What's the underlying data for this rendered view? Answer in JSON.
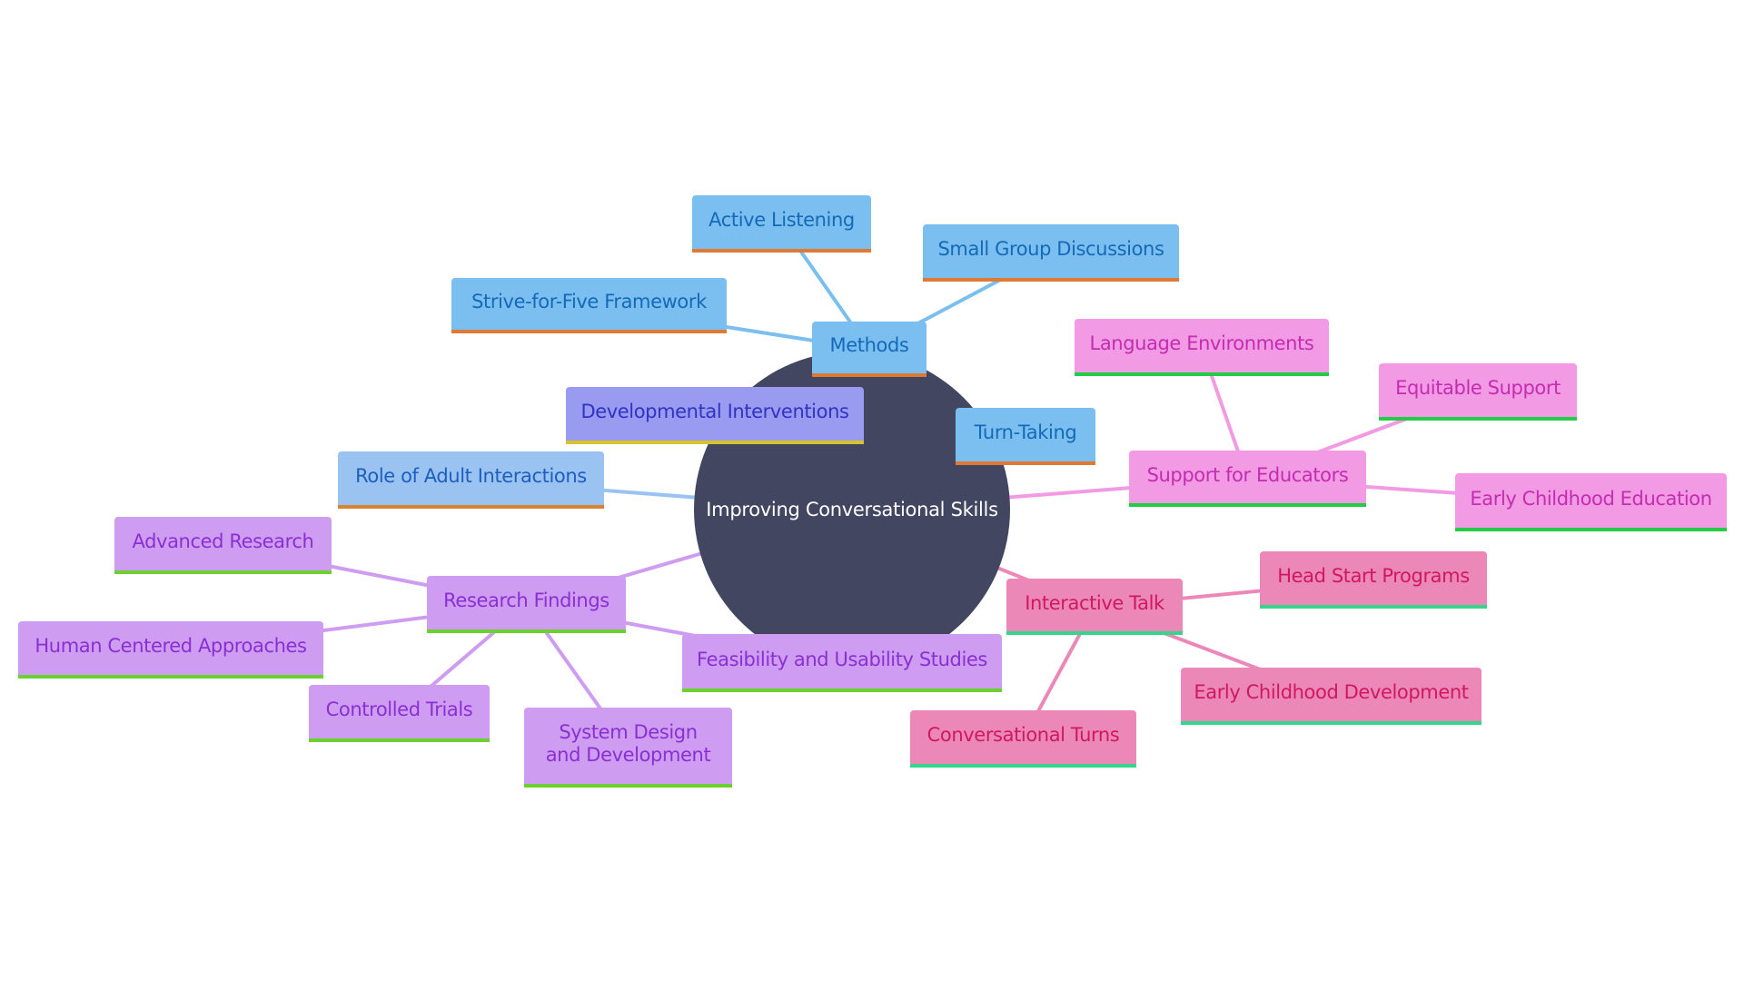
{
  "root": {
    "id": "root",
    "label": "Improving Conversational Skills"
  },
  "colors": {
    "center": "#424660",
    "methods_fill": "#7bbff0",
    "methods_edge": "#7bbff0",
    "adult_edge": "#9ac3f2",
    "research_edge": "#ce9cf0",
    "educators_edge": "#f29ae3",
    "talk_edge": "#ec88b8"
  },
  "nodes": [
    {
      "id": "methods",
      "label": "Methods",
      "parent": "root",
      "style": "blue",
      "edge": "#7bbff0"
    },
    {
      "id": "active-listening",
      "label": "Active Listening",
      "parent": "methods",
      "style": "blue",
      "edge": "#7bbff0"
    },
    {
      "id": "small-group-discussions",
      "label": "Small Group Discussions",
      "parent": "methods",
      "style": "blue",
      "edge": "#7bbff0"
    },
    {
      "id": "strive-for-five",
      "label": "Strive-for-Five Framework",
      "parent": "methods",
      "style": "blue",
      "edge": "#7bbff0"
    },
    {
      "id": "turn-taking",
      "label": "Turn-Taking",
      "parent": "root",
      "style": "blue",
      "edge": "#7bbff0"
    },
    {
      "id": "developmental-interventions",
      "label": "Developmental Interventions",
      "parent": "root",
      "style": "indigo",
      "edge": "#999bf0"
    },
    {
      "id": "role-of-adult-interactions",
      "label": "Role of Adult Interactions",
      "parent": "root",
      "style": "lblue",
      "edge": "#9ac3f2"
    },
    {
      "id": "support-for-educators",
      "label": "Support for Educators",
      "parent": "root",
      "style": "orchid",
      "edge": "#f29ae3"
    },
    {
      "id": "language-environments",
      "label": "Language Environments",
      "parent": "support-for-educators",
      "style": "orchid",
      "edge": "#f29ae3"
    },
    {
      "id": "equitable-support",
      "label": "Equitable Support",
      "parent": "support-for-educators",
      "style": "orchid",
      "edge": "#f29ae3"
    },
    {
      "id": "early-childhood-education",
      "label": "Early Childhood Education",
      "parent": "support-for-educators",
      "style": "orchid",
      "edge": "#f29ae3"
    },
    {
      "id": "interactive-talk",
      "label": "Interactive Talk",
      "parent": "root",
      "style": "rose",
      "edge": "#ec88b8"
    },
    {
      "id": "head-start-programs",
      "label": "Head Start Programs",
      "parent": "interactive-talk",
      "style": "rose",
      "edge": "#ec88b8"
    },
    {
      "id": "early-childhood-development",
      "label": "Early Childhood Development",
      "parent": "interactive-talk",
      "style": "rose",
      "edge": "#ec88b8"
    },
    {
      "id": "conversational-turns",
      "label": "Conversational Turns",
      "parent": "interactive-talk",
      "style": "rose",
      "edge": "#ec88b8"
    },
    {
      "id": "research-findings",
      "label": "Research Findings",
      "parent": "root",
      "style": "violet",
      "edge": "#ce9cf0"
    },
    {
      "id": "feasibility-and-usability-studies",
      "label": "Feasibility and Usability Studies",
      "parent": "research-findings",
      "style": "violet",
      "edge": "#ce9cf0"
    },
    {
      "id": "advanced-research",
      "label": "Advanced Research",
      "parent": "research-findings",
      "style": "violet",
      "edge": "#ce9cf0"
    },
    {
      "id": "human-centered-approaches",
      "label": "Human Centered Approaches",
      "parent": "research-findings",
      "style": "violet",
      "edge": "#ce9cf0"
    },
    {
      "id": "controlled-trials",
      "label": "Controlled Trials",
      "parent": "research-findings",
      "style": "violet",
      "edge": "#ce9cf0"
    },
    {
      "id": "system-design-and-development",
      "label": "System Design and Development",
      "parent": "research-findings",
      "style": "violet",
      "edge": "#ce9cf0"
    }
  ]
}
